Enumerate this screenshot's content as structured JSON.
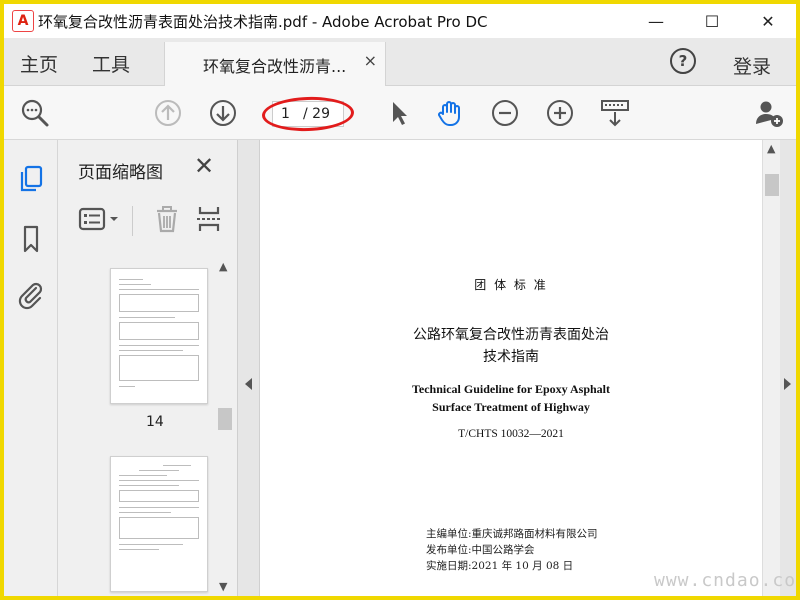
{
  "window": {
    "title": "环氧复合改性沥青表面处治技术指南.pdf - Adobe Acrobat Pro DC",
    "app_icon_glyph": "㉑",
    "minimize": "—",
    "maximize": "☐",
    "close": "✕"
  },
  "tabs": {
    "home": "主页",
    "tools": "工具",
    "doc_tab": "环氧复合改性沥青...",
    "doc_tab_close": "×",
    "help": "?",
    "login": "登录"
  },
  "toolbar": {
    "page_current": "1",
    "page_total": "/ 29",
    "icons": [
      "zoom-search-icon",
      "page-up-icon",
      "page-down-icon",
      "select-arrow-icon",
      "hand-tool-icon",
      "zoom-out-icon",
      "zoom-in-icon",
      "keyboard-scroll-icon",
      "add-user-icon"
    ]
  },
  "panel": {
    "title": "页面缩略图",
    "close": "✕",
    "thumbnails": [
      {
        "label": "14"
      },
      {
        "label": ""
      }
    ]
  },
  "document": {
    "category": "团 体 标 准",
    "title_cn_line1": "公路环氧复合改性沥青表面处治",
    "title_cn_line2": "技术指南",
    "title_en_line1": "Technical Guideline for Epoxy Asphalt",
    "title_en_line2": "Surface Treatment of Highway",
    "code": "T/CHTS  10032—2021",
    "editor": "主编单位:重庆诚邦路面材料有限公司",
    "publisher": "发布单位:中国公路学会",
    "date": "实施日期:2021 年 10 月 08 日"
  },
  "watermark": "www.cndao.com",
  "colors": {
    "accent_blue": "#1473e6",
    "annotation_red": "#e21c1c",
    "frame_yellow": "#f0d800"
  }
}
